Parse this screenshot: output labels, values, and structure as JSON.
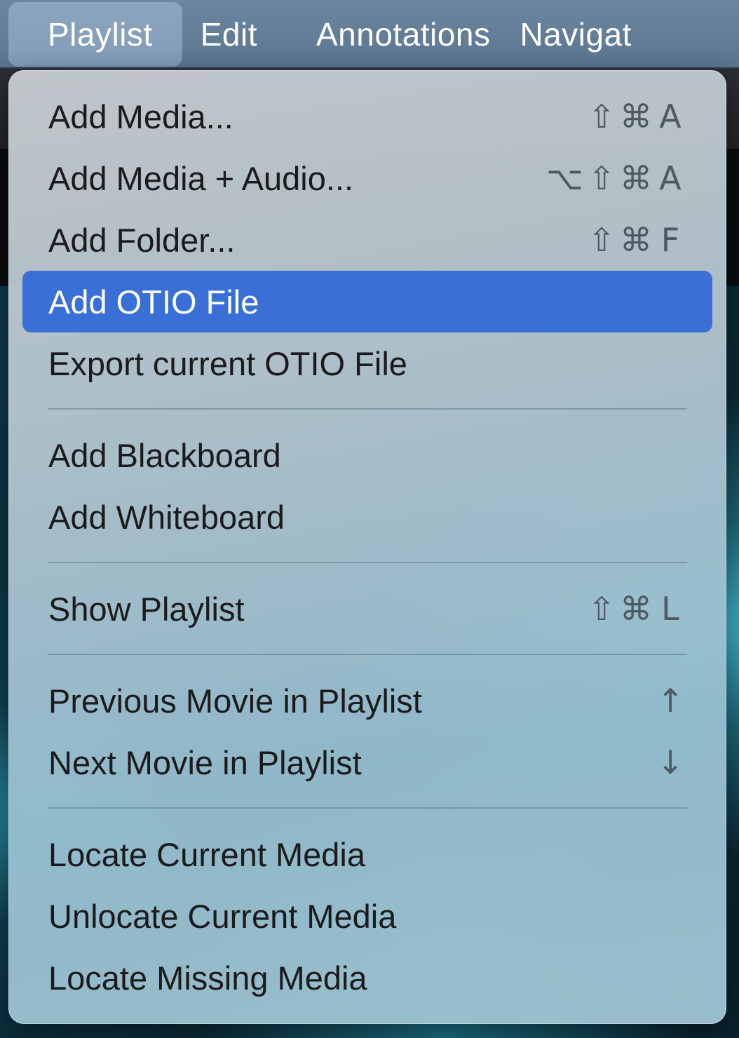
{
  "menubar": {
    "items": [
      {
        "label": "Playlist",
        "active": true
      },
      {
        "label": "Edit"
      },
      {
        "label": "Annotations"
      },
      {
        "label": "Navigat"
      }
    ]
  },
  "menu": {
    "highlight_color": "#3a6fd8",
    "groups": [
      [
        {
          "label": "Add Media...",
          "shortcut": [
            "⇧",
            "⌘",
            "A"
          ]
        },
        {
          "label": "Add Media + Audio...",
          "shortcut": [
            "⌥",
            "⇧",
            "⌘",
            "A"
          ]
        },
        {
          "label": "Add Folder...",
          "shortcut": [
            "⇧",
            "⌘",
            "F"
          ]
        },
        {
          "label": "Add OTIO File",
          "highlighted": true
        },
        {
          "label": "Export current OTIO File"
        }
      ],
      [
        {
          "label": "Add Blackboard"
        },
        {
          "label": "Add Whiteboard"
        }
      ],
      [
        {
          "label": "Show Playlist",
          "shortcut": [
            "⇧",
            "⌘",
            "L"
          ]
        }
      ],
      [
        {
          "label": "Previous Movie in Playlist",
          "shortcut": [
            "↑"
          ]
        },
        {
          "label": "Next Movie in Playlist",
          "shortcut": [
            "↓"
          ]
        }
      ],
      [
        {
          "label": "Locate Current Media"
        },
        {
          "label": "Unlocate Current Media"
        },
        {
          "label": "Locate Missing Media"
        }
      ]
    ]
  }
}
